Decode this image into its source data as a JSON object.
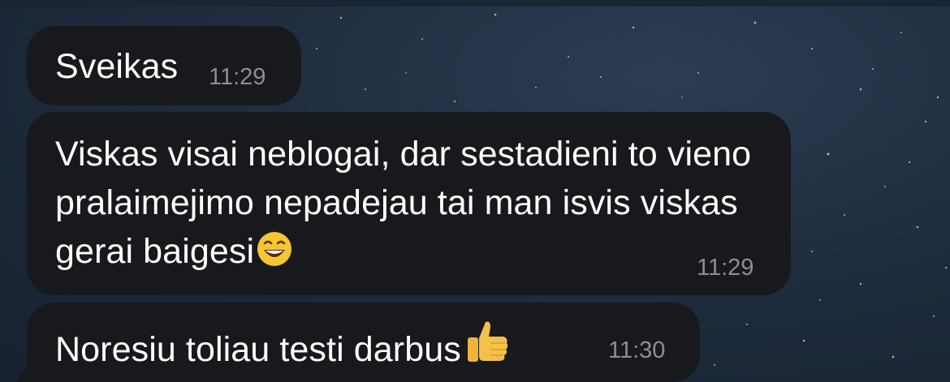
{
  "messages": [
    {
      "text": "Sveikas",
      "time": "11:29"
    },
    {
      "text": "Viskas visai neblogai, dar sestadieni to vieno pralaimejimo nepadejau tai man isvis viskas gerai baigesi",
      "emoji": "grinning-face-icon",
      "time": "11:29"
    },
    {
      "text": "Noresiu toliau testi darbus",
      "emoji": "thumbs-up-icon",
      "time": "11:30"
    }
  ],
  "colors": {
    "background": "#1d2a3b",
    "bubble": "#18191d",
    "text": "#ffffff",
    "time": "#8c8e93"
  }
}
